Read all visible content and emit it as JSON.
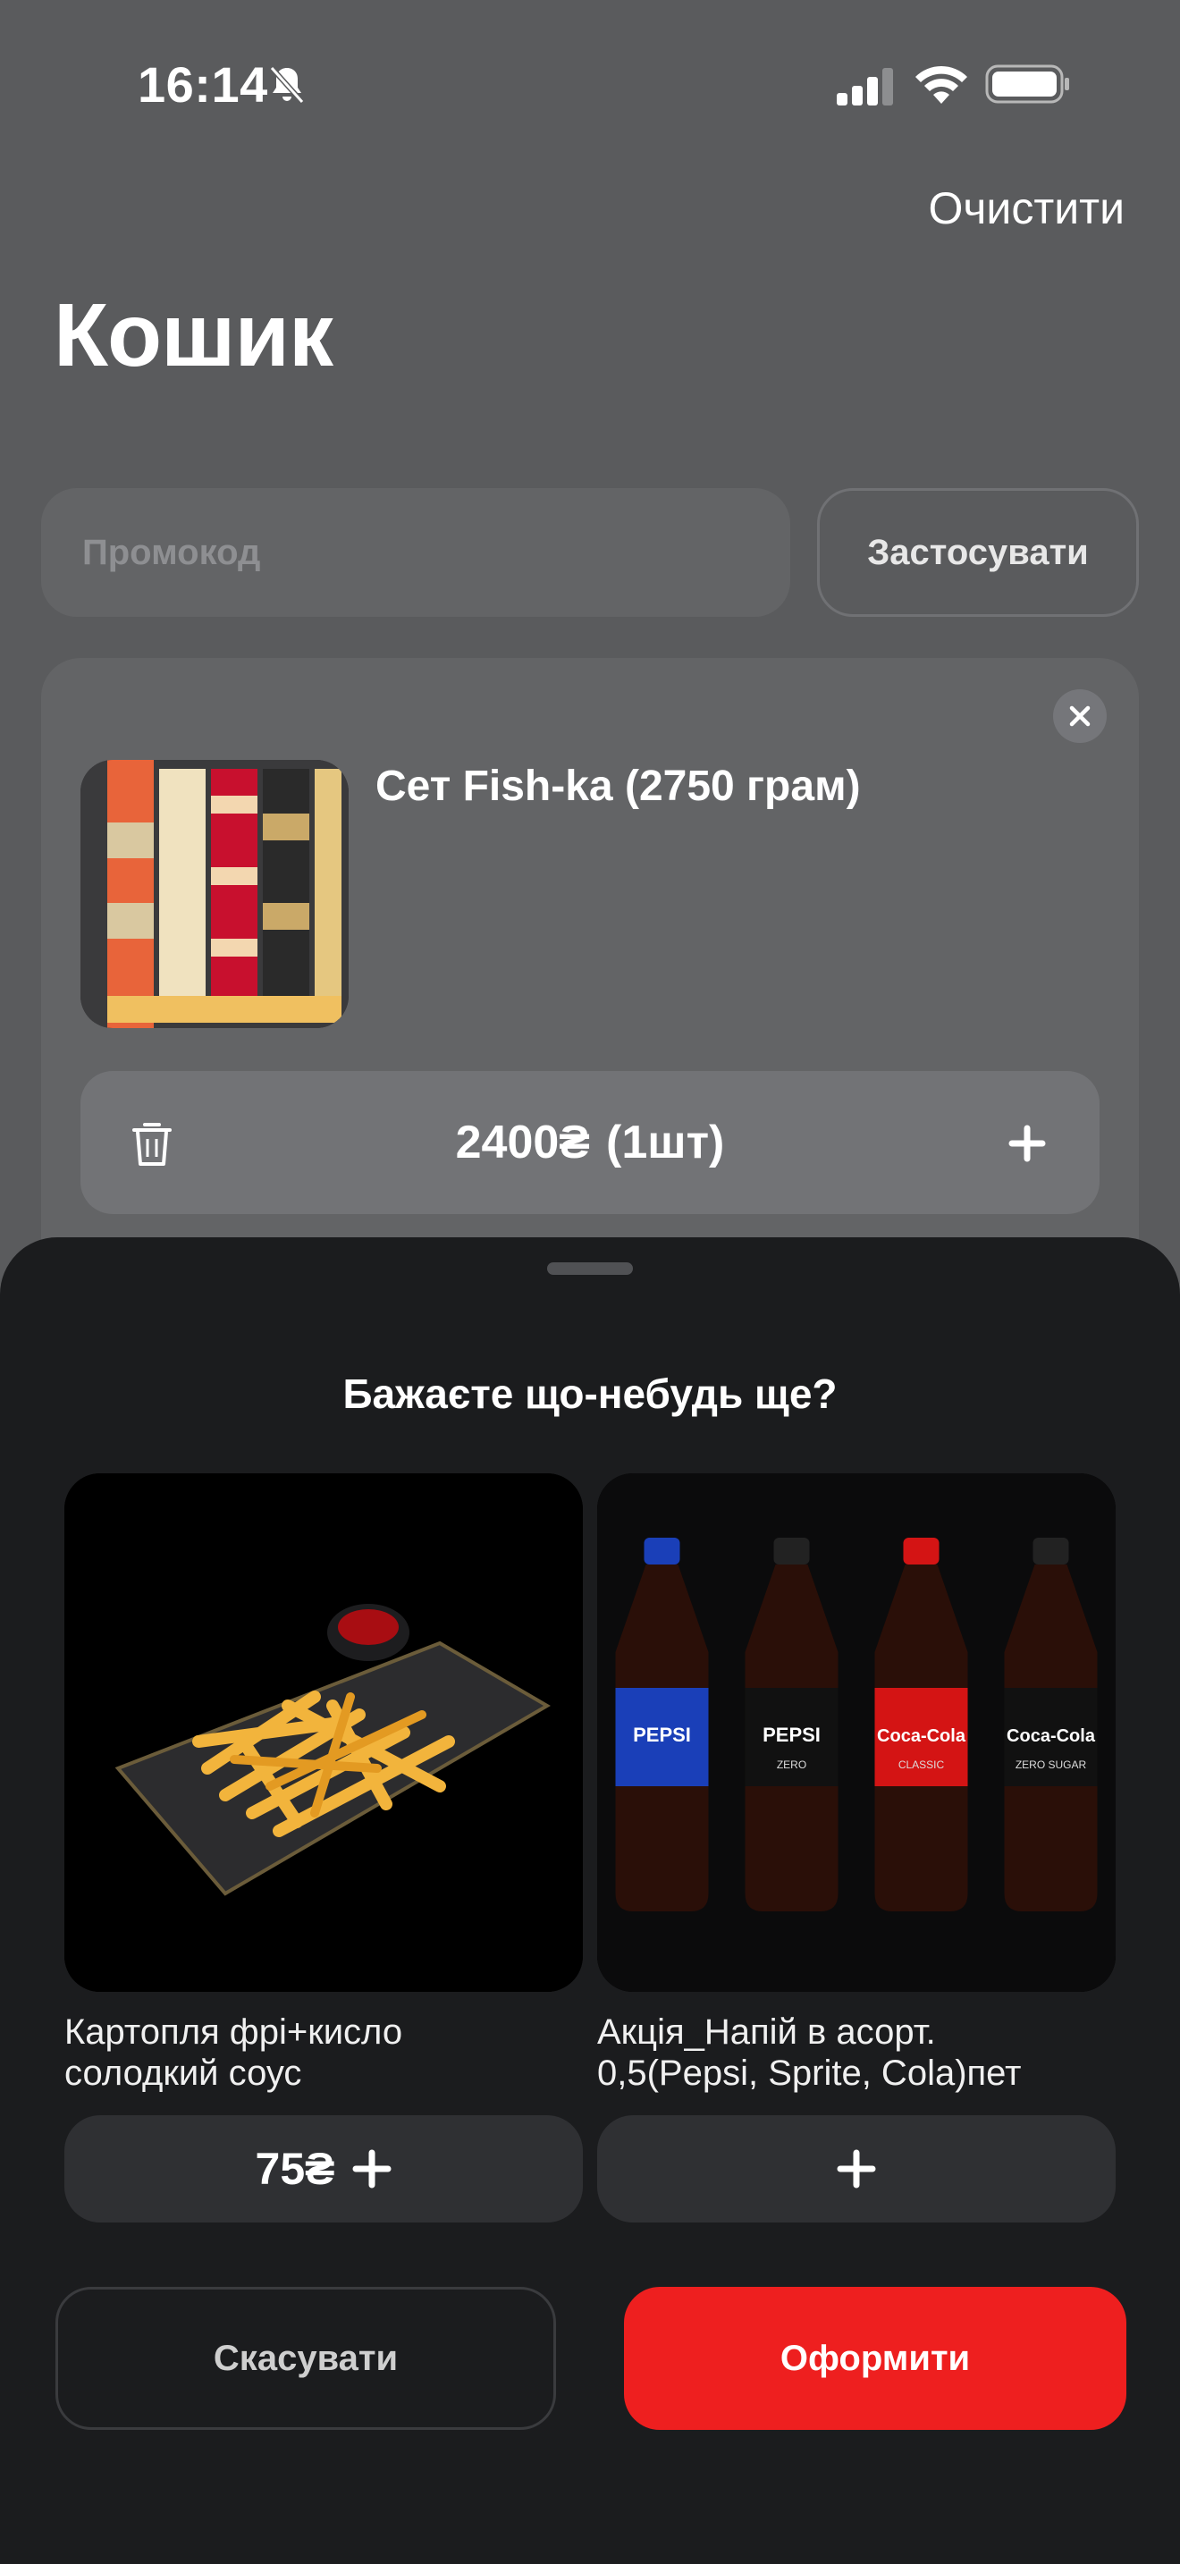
{
  "status_bar": {
    "time": "16:14"
  },
  "header": {
    "clear_label": "Очистити",
    "title": "Кошик"
  },
  "promo": {
    "placeholder": "Промокод",
    "apply_label": "Застосувати"
  },
  "cart_items": [
    {
      "name": "Сет Fish-ka (2750 грам)",
      "price": "2400₴",
      "quantity": "(1шт)"
    }
  ],
  "upsell": {
    "title": "Бажаєте що-небудь ще?",
    "products": [
      {
        "name_line1": "Картопля фрі+кисло",
        "name_line2": "солодкий соус",
        "price": "75₴"
      },
      {
        "name_line1": "Акція_Напій в асорт.",
        "name_line2": "0,5(Pepsi, Sprite, Cola)пет",
        "price": ""
      }
    ],
    "drinks": [
      {
        "brand": "PEPSI",
        "sub": "",
        "bottle_color": "#1a3fb8"
      },
      {
        "brand": "PEPSI",
        "sub": "ZERO",
        "bottle_color": "#111111"
      },
      {
        "brand": "Coca-Cola",
        "sub": "CLASSIC",
        "bottle_color": "#d41414"
      },
      {
        "brand": "Coca-Cola",
        "sub": "ZERO SUGAR",
        "bottle_color": "#111111"
      }
    ]
  },
  "actions": {
    "cancel_label": "Скасувати",
    "checkout_label": "Оформити"
  },
  "colors": {
    "accent": "#ee1f1f",
    "sheet_bg": "#1b1c1e"
  }
}
